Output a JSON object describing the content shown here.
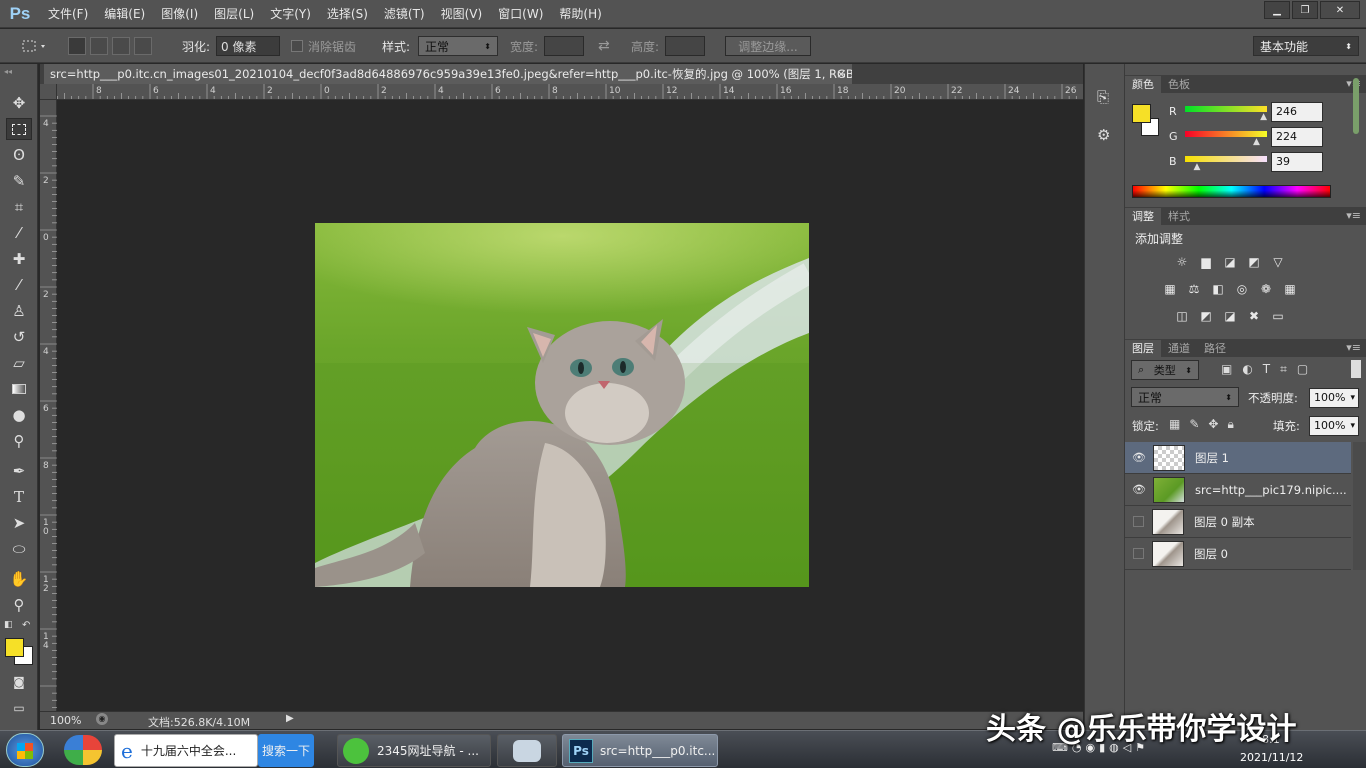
{
  "app": {
    "logo": "Ps"
  },
  "menu": [
    "文件(F)",
    "编辑(E)",
    "图像(I)",
    "图层(L)",
    "文字(Y)",
    "选择(S)",
    "滤镜(T)",
    "视图(V)",
    "窗口(W)",
    "帮助(H)"
  ],
  "window_controls": {
    "minimize": "▁",
    "restore": "❐",
    "close": "✕"
  },
  "options": {
    "feather_label": "羽化:",
    "feather_value": "0 像素",
    "antialias_label": "消除锯齿",
    "style_label": "样式:",
    "style_value": "正常",
    "width_label": "宽度:",
    "height_label": "高度:",
    "refine_edge": "调整边缘...",
    "workspace": "基本功能"
  },
  "tools": [
    "move-tool",
    "marquee-tool",
    "lasso-tool",
    "quick-select-tool",
    "crop-tool",
    "eyedropper-tool",
    "spot-heal-tool",
    "brush-tool",
    "clone-stamp-tool",
    "history-brush-tool",
    "eraser-tool",
    "gradient-tool",
    "blur-tool",
    "dodge-tool",
    "pen-tool",
    "type-tool",
    "path-select-tool",
    "ellipse-tool",
    "hand-tool",
    "zoom-tool"
  ],
  "document": {
    "tab_title": "src=http___p0.itc.cn_images01_20210104_decf0f3ad8d64886976c959a39e13fe0.jpeg&refer=http___p0.itc-恢复的.jpg @ 100% (图层 1, RGB/8#) *",
    "tab_close": "×"
  },
  "rulers": {
    "top": [
      "8",
      "6",
      "4",
      "2",
      "0",
      "2",
      "4",
      "6",
      "8",
      "10",
      "12",
      "14",
      "16",
      "18",
      "20",
      "22",
      "24",
      "26"
    ],
    "left": [
      "4",
      "2",
      "0",
      "2",
      "4",
      "6",
      "8",
      "1\n0",
      "1\n2",
      "1\n4"
    ]
  },
  "status": {
    "zoom": "100%",
    "doc_info": "文档:526.8K/4.10M"
  },
  "colors": {
    "foreground": "#f6e027",
    "background": "#ffffff",
    "accent_selection": "#5d6a7e",
    "r_value": 0.965,
    "g_value": 0.878,
    "b_value": 0.153
  },
  "color_panel": {
    "tabs": [
      "颜色",
      "色板"
    ],
    "r_label": "R",
    "r": "246",
    "g_label": "G",
    "g": "224",
    "b_label": "B",
    "b": "39"
  },
  "adjust_panel": {
    "tabs": [
      "调整",
      "样式"
    ],
    "title": "添加调整",
    "icons_row1": [
      "brightness-icon",
      "levels-icon",
      "curves-icon",
      "exposure-icon",
      "vibrance-icon"
    ],
    "icons_row2": [
      "hue-sat-icon",
      "color-balance-icon",
      "bw-icon",
      "photo-filter-icon",
      "channel-mixer-icon",
      "color-lookup-icon"
    ],
    "icons_row3": [
      "invert-icon",
      "posterize-icon",
      "threshold-icon",
      "selective-color-icon",
      "gradient-map-icon"
    ]
  },
  "layers_panel": {
    "tabs": [
      "图层",
      "通道",
      "路径"
    ],
    "filter_kind": "类型",
    "blend_mode": "正常",
    "opacity_label": "不透明度:",
    "opacity": "100%",
    "lock_label": "锁定:",
    "fill_label": "填充:",
    "fill": "100%",
    "layers": [
      {
        "name": "图层 1",
        "visible": true,
        "selected": true
      },
      {
        "name": "src=http___pic179.nipic....",
        "visible": true,
        "selected": false
      },
      {
        "name": "图层 0 副本",
        "visible": false,
        "selected": false
      },
      {
        "name": "图层 0",
        "visible": false,
        "selected": false
      }
    ]
  },
  "taskbar": {
    "tasks": [
      "十九届六中全会...",
      "搜索一下",
      "2345网址导航 - ...",
      "src=http___p0.itc..."
    ],
    "clock_time": "8:1",
    "clock_date": "2021/11/12"
  },
  "watermark": "头条 @乐乐带你学设计"
}
